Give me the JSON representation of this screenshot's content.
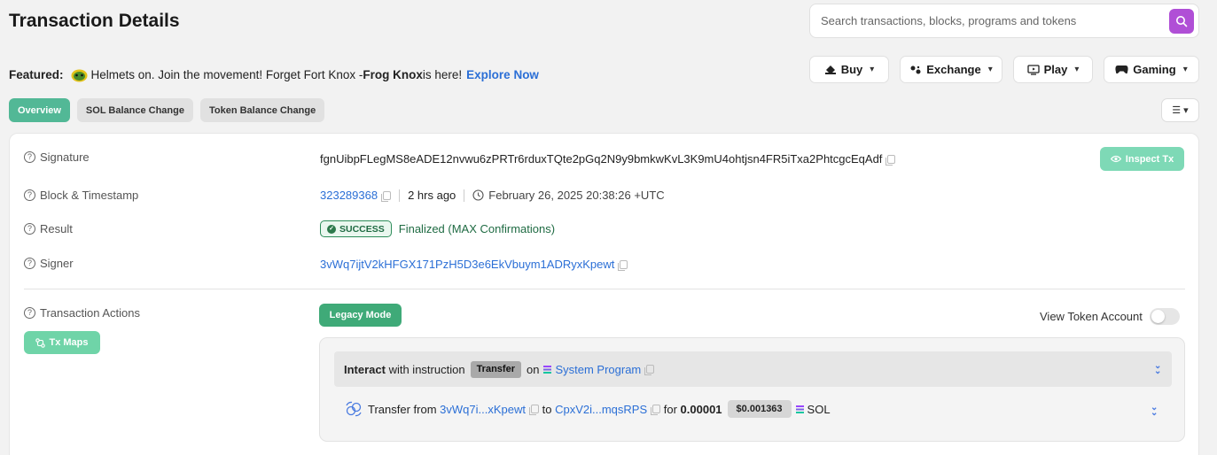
{
  "header": {
    "title": "Transaction Details",
    "search_placeholder": "Search transactions, blocks, programs and tokens"
  },
  "featured": {
    "label": "Featured:",
    "text": "Helmets on. Join the movement! Forget Fort Knox - ",
    "bold": "Frog Knox",
    "suffix": " is here!",
    "link": "Explore Now"
  },
  "topnav": {
    "buy": "Buy",
    "exchange": "Exchange",
    "play": "Play",
    "gaming": "Gaming"
  },
  "tabs": [
    "Overview",
    "SOL Balance Change",
    "Token Balance Change"
  ],
  "details": {
    "signature_label": "Signature",
    "signature": "fgnUibpFLegMS8eADE12nvwu6zPRTr6rduxTQte2pGq2N9y9bmkwKvL3K9mU4ohtjsn4FR5iTxa2PhtcgcEqAdf",
    "inspect_label": "Inspect Tx",
    "block_label": "Block & Timestamp",
    "block": "323289368",
    "ago": "2 hrs ago",
    "timestamp": "February 26, 2025 20:38:26 +UTC",
    "result_label": "Result",
    "result_badge": "SUCCESS",
    "result_text": "Finalized (MAX Confirmations)",
    "signer_label": "Signer",
    "signer": "3vWq7ijtV2kHFGX171PzH5D3e6EkVbuym1ADRyxKpewt"
  },
  "actions": {
    "label": "Transaction Actions",
    "legacy_label": "Legacy Mode",
    "txmaps_label": "Tx Maps",
    "view_token_label": "View Token Account",
    "interact": "Interact",
    "with_instruction": " with instruction",
    "instruction": "Transfer",
    "on": "on",
    "program": "System Program",
    "transfer_from": "Transfer from",
    "from_addr": "3vWq7i...xKpewt",
    "to": "to",
    "to_addr": "CpxV2i...mqsRPS",
    "for": "for",
    "amount": "0.00001",
    "usd": "$0.001363",
    "token": "SOL"
  },
  "colors": {
    "accent_green": "#52b896",
    "link_blue": "#2b6fd6",
    "search_purple": "#b04fd6"
  }
}
